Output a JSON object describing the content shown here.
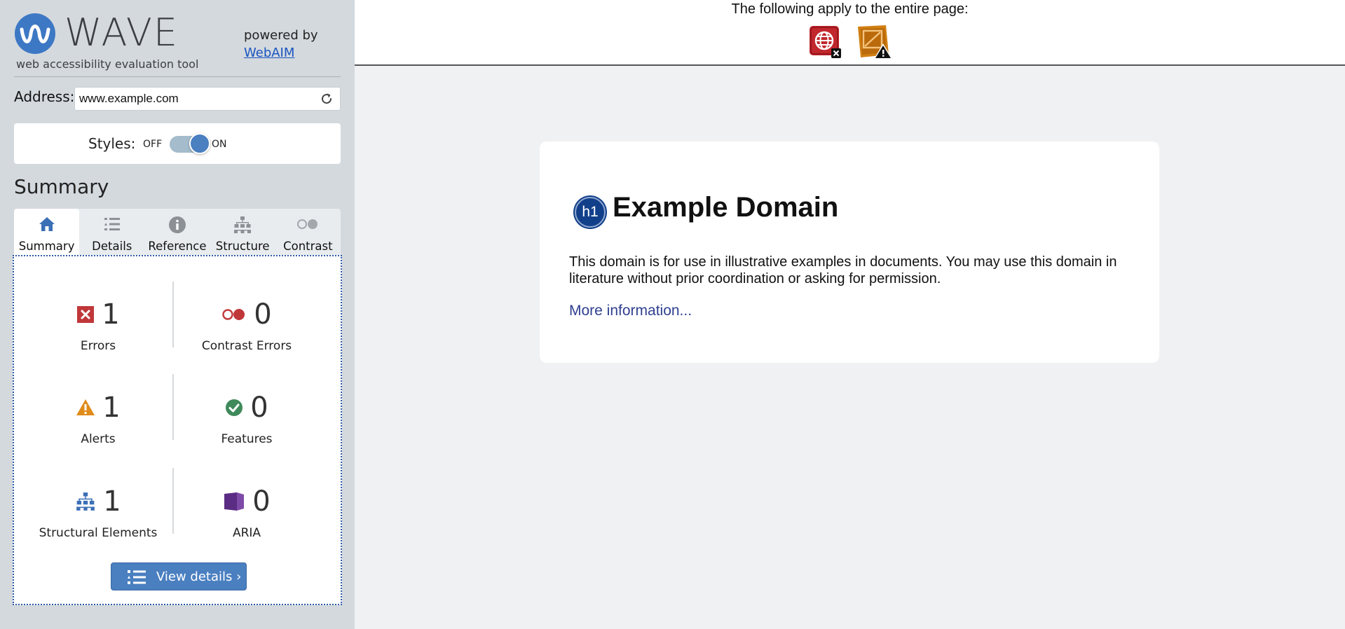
{
  "brand": {
    "name": "WAVE",
    "tagline": "web accessibility evaluation tool",
    "powered_by": "powered by",
    "powered_link": "WebAIM"
  },
  "address": {
    "label": "Address:",
    "value": "www.example.com"
  },
  "styles": {
    "label": "Styles:",
    "off_label": "OFF",
    "on_label": "ON",
    "state": "on"
  },
  "summary": {
    "heading": "Summary",
    "tabs": [
      {
        "label": "Summary",
        "icon": "home-icon",
        "active": true
      },
      {
        "label": "Details",
        "icon": "list-icon",
        "active": false
      },
      {
        "label": "Reference",
        "icon": "info-icon",
        "active": false
      },
      {
        "label": "Structure",
        "icon": "structure-icon",
        "active": false
      },
      {
        "label": "Contrast",
        "icon": "contrast-icon",
        "active": false
      }
    ],
    "stats": [
      {
        "key": "errors",
        "count": "1",
        "label": "Errors",
        "icon": "error-icon",
        "color": "#c0373a"
      },
      {
        "key": "contrast",
        "count": "0",
        "label": "Contrast Errors",
        "icon": "contrast-error-icon",
        "color": "#c0373a"
      },
      {
        "key": "alerts",
        "count": "1",
        "label": "Alerts",
        "icon": "alert-icon",
        "color": "#e08b1a"
      },
      {
        "key": "features",
        "count": "0",
        "label": "Features",
        "icon": "feature-icon",
        "color": "#3f8a5b"
      },
      {
        "key": "structure",
        "count": "1",
        "label": "Structural Elements",
        "icon": "structure-icon",
        "color": "#3b6fb6"
      },
      {
        "key": "aria",
        "count": "0",
        "label": "ARIA",
        "icon": "aria-icon",
        "color": "#5b2c83"
      }
    ],
    "view_details_label": "View details ›"
  },
  "main": {
    "banner_text": "The following apply to the entire page:",
    "page_icons": [
      {
        "name": "language-missing-error-icon",
        "color": "#c1272d"
      },
      {
        "name": "zoom-disabled-alert-icon",
        "color": "#d07f12"
      }
    ],
    "example": {
      "h1_badge": "h1",
      "title": "Example Domain",
      "paragraph": "This domain is for use in illustrative examples in documents. You may use this domain in literature without prior coordination or asking for permission.",
      "link": "More information..."
    }
  }
}
